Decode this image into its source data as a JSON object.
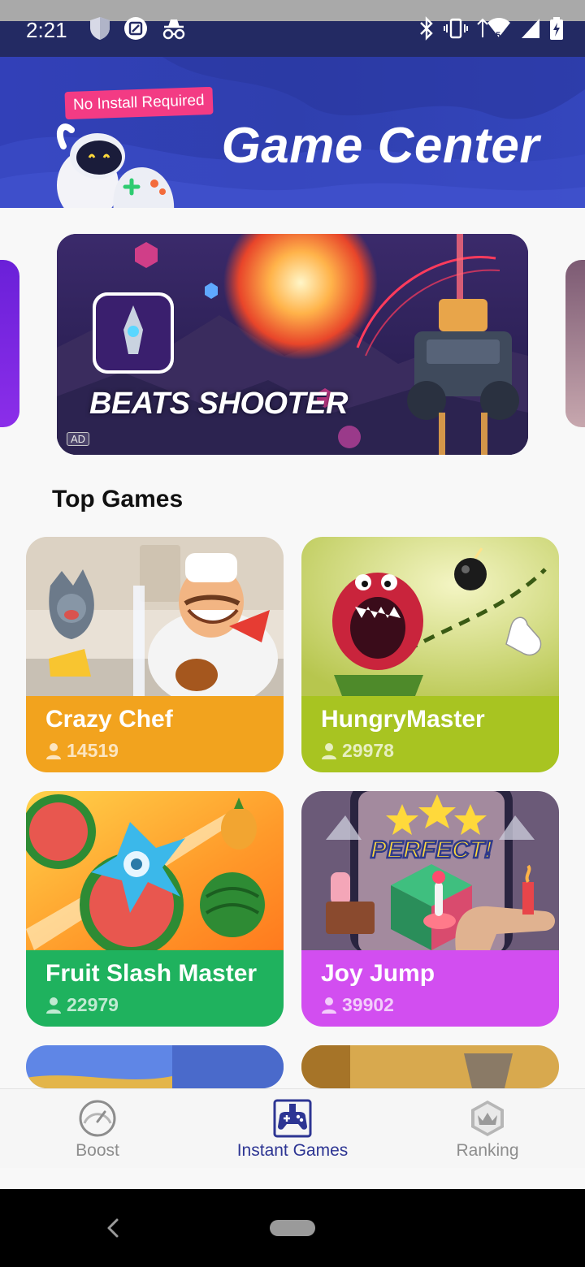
{
  "status_bar": {
    "time": "2:21"
  },
  "header": {
    "badge": "No Install Required",
    "title": "Game Center"
  },
  "banner": {
    "title": "BEATS SHOOTER",
    "ad_label": "AD"
  },
  "section": {
    "title": "Top Games"
  },
  "games": [
    {
      "name": "Crazy Chef",
      "plays": "14519",
      "color": "#f2a31e"
    },
    {
      "name": "HungryMaster",
      "plays": "29978",
      "color": "#a8c421"
    },
    {
      "name": "Fruit Slash Master",
      "plays": "22979",
      "color": "#1fb25e"
    },
    {
      "name": "Joy Jump",
      "plays": "39902",
      "color": "#d24ef0"
    }
  ],
  "bottom_nav": {
    "items": [
      {
        "label": "Boost",
        "icon": "speedometer-icon"
      },
      {
        "label": "Instant Games",
        "icon": "gamepad-icon",
        "active": true
      },
      {
        "label": "Ranking",
        "icon": "crown-icon"
      }
    ]
  },
  "colors": {
    "header_bg": "#3240b8",
    "accent": "#2d3593",
    "badge_bg": "#f33b84"
  }
}
